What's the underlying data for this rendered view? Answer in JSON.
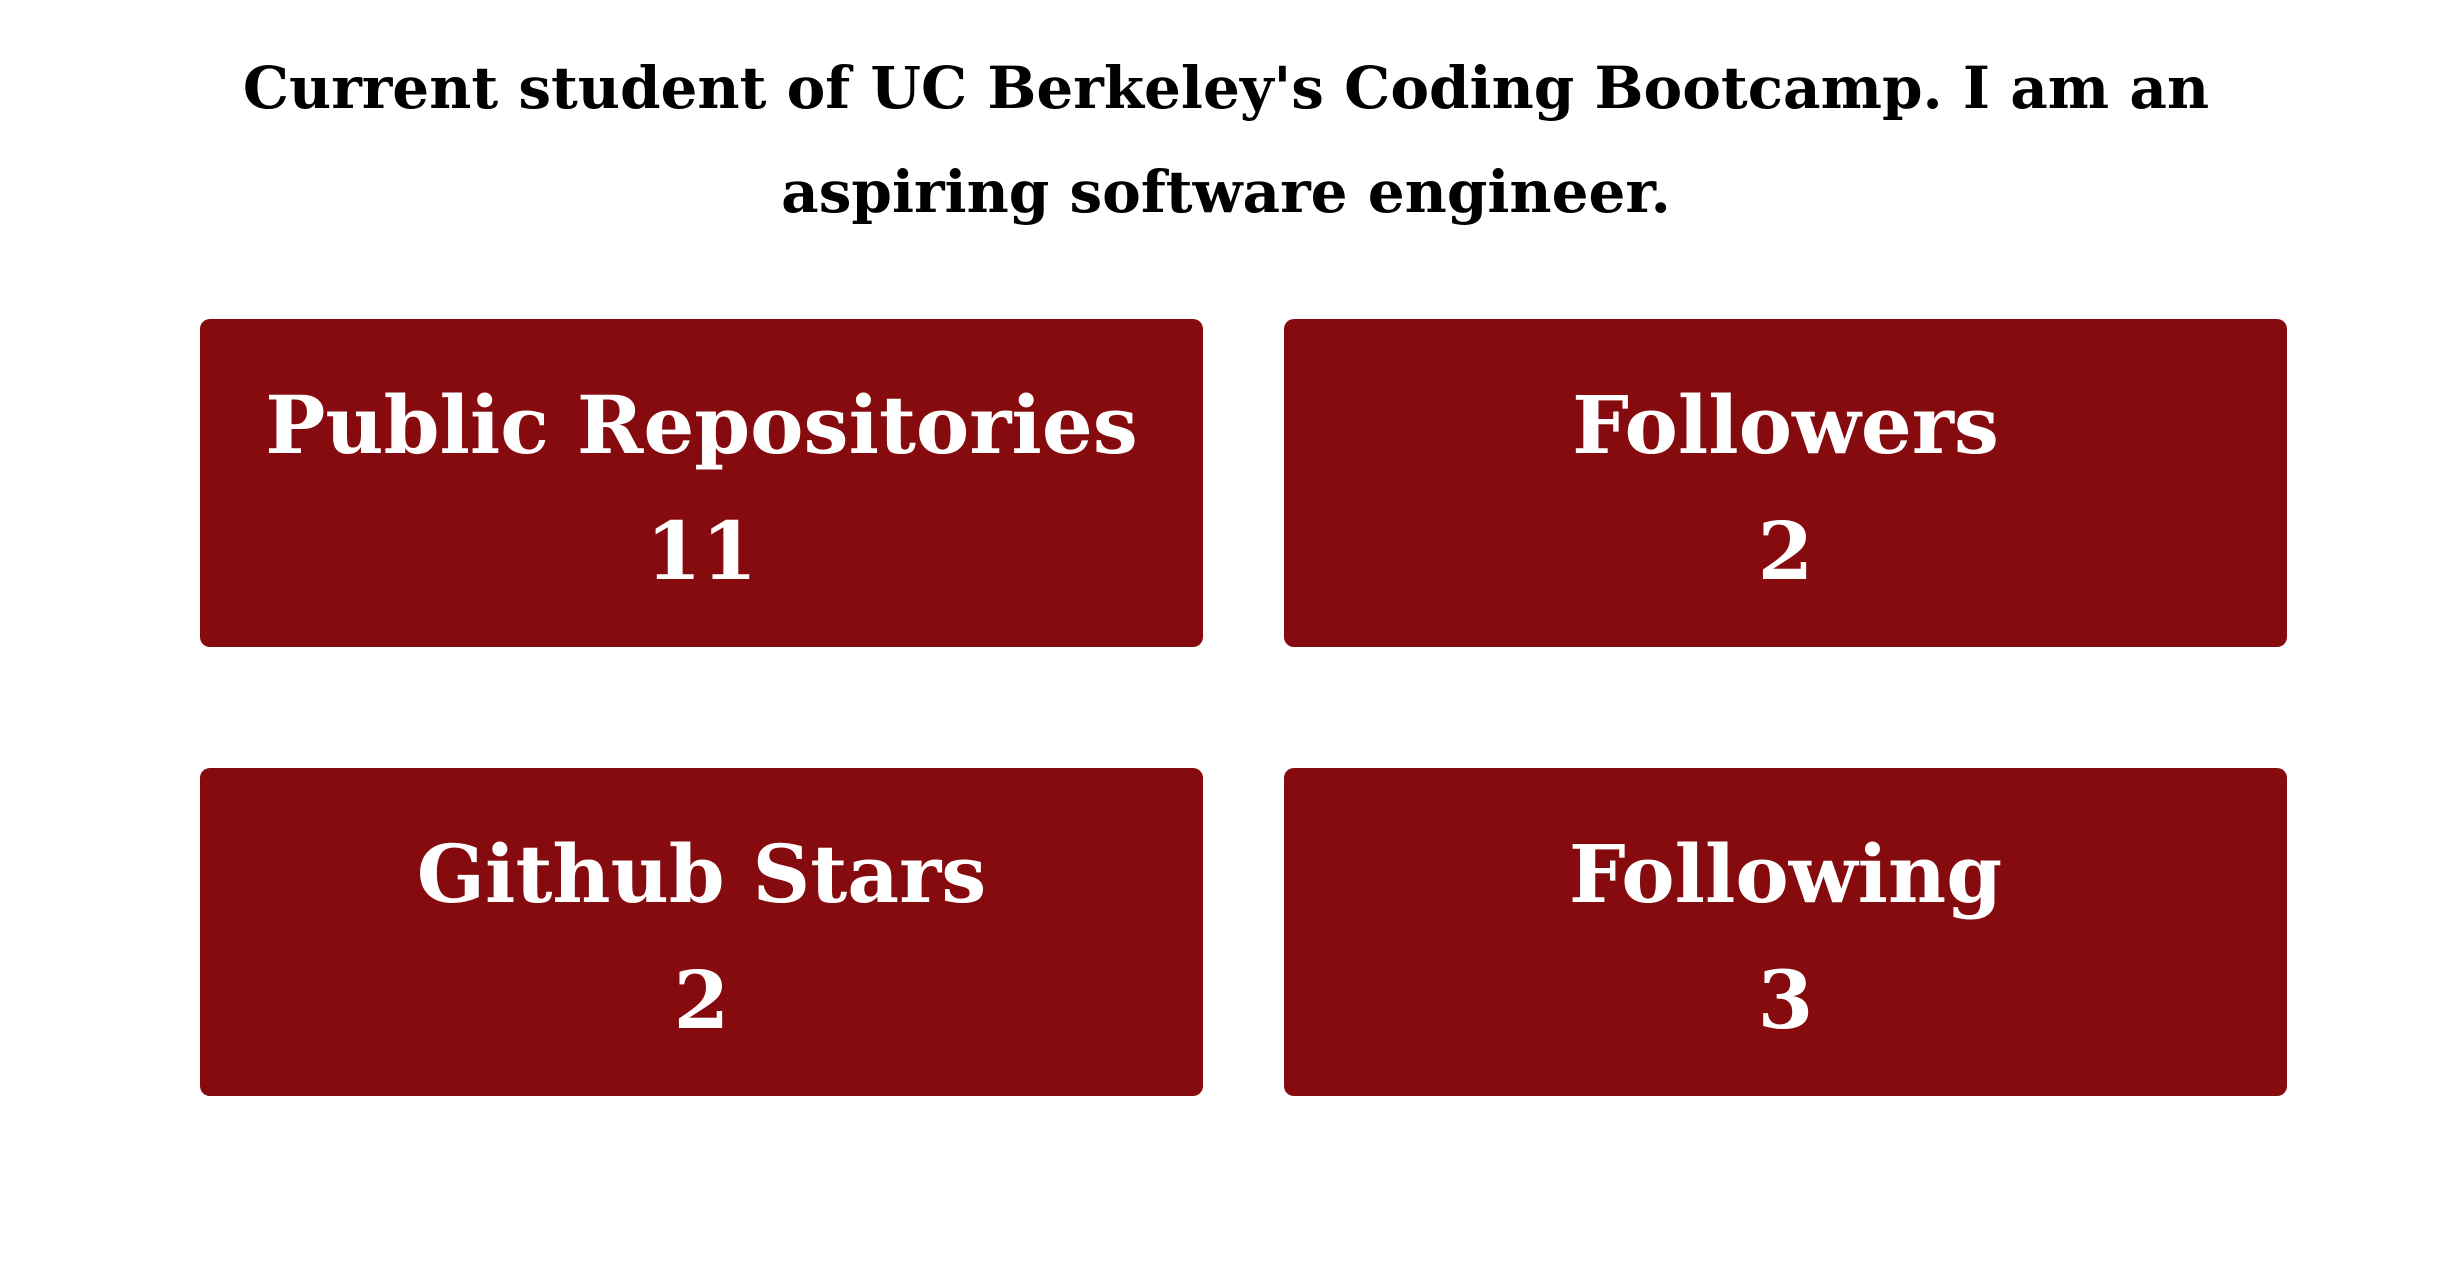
{
  "bio": {
    "line1": "Current student of UC Berkeley's Coding Bootcamp. I am an",
    "line2": "aspiring software engineer."
  },
  "stats": {
    "public_repositories": {
      "label": "Public Repositories",
      "value": "11"
    },
    "followers": {
      "label": "Followers",
      "value": "2"
    },
    "github_stars": {
      "label": "Github Stars",
      "value": "2"
    },
    "following": {
      "label": "Following",
      "value": "3"
    }
  },
  "colors": {
    "card_background": "#860b0e",
    "card_text": "#ffffff",
    "bio_text": "#000000",
    "page_background": "#ffffff"
  }
}
